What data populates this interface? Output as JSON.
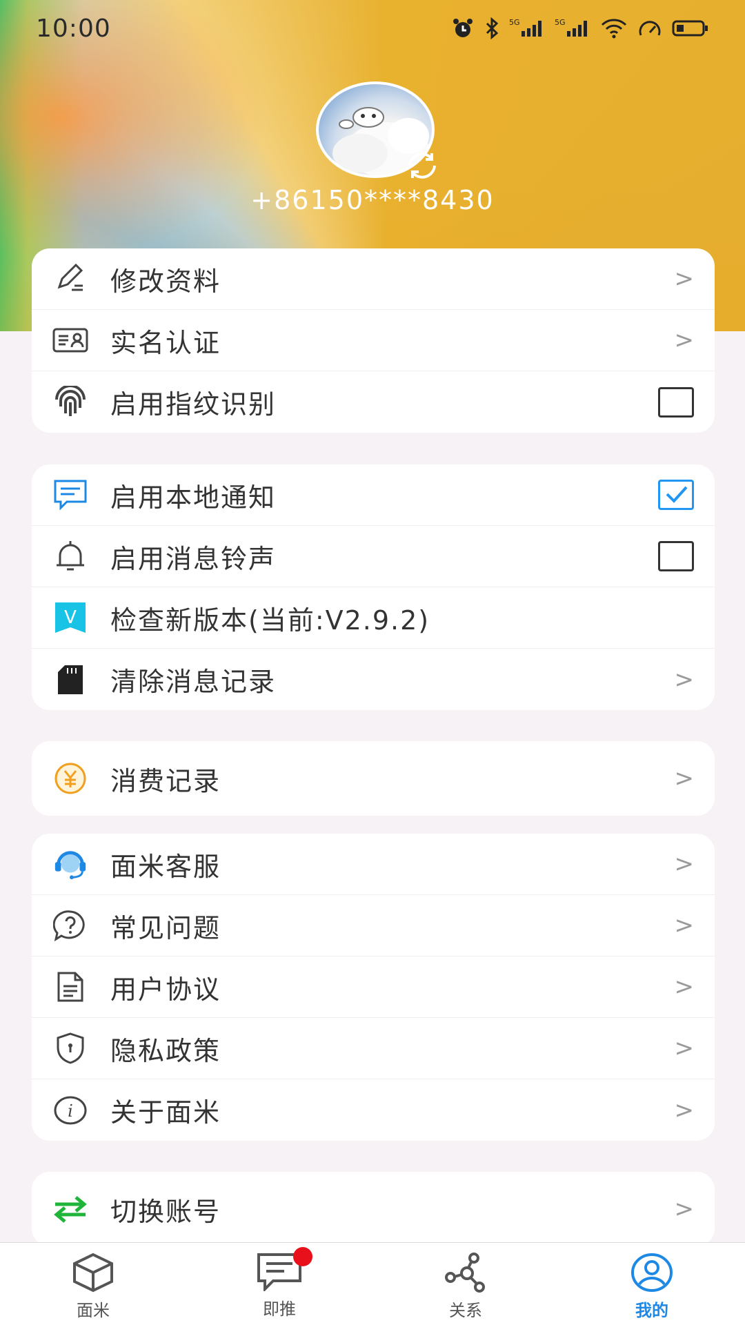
{
  "status_bar": {
    "time": "10:00"
  },
  "profile": {
    "phone": "+86150****8430"
  },
  "groups": [
    {
      "items": [
        {
          "label": "修改资料",
          "icon": "edit-icon",
          "control": ">"
        },
        {
          "label": "实名认证",
          "icon": "id-card-icon",
          "control": ">"
        },
        {
          "label": "启用指纹识别",
          "icon": "fingerprint-icon",
          "checked": false
        }
      ]
    },
    {
      "items": [
        {
          "label": "启用本地通知",
          "icon": "message-icon",
          "checked": true
        },
        {
          "label": "启用消息铃声",
          "icon": "bell-icon",
          "checked": false
        },
        {
          "label": "检查新版本(当前:V2.9.2)",
          "icon": "version-icon"
        },
        {
          "label": "清除消息记录",
          "icon": "sd-card-icon",
          "control": ">"
        }
      ]
    },
    {
      "items": [
        {
          "label": "消费记录",
          "icon": "yuan-icon",
          "control": ">"
        }
      ]
    },
    {
      "items": [
        {
          "label": "面米客服",
          "icon": "customer-service-icon",
          "control": ">"
        },
        {
          "label": "常见问题",
          "icon": "question-icon",
          "control": ">"
        },
        {
          "label": "用户协议",
          "icon": "document-icon",
          "control": ">"
        },
        {
          "label": "隐私政策",
          "icon": "shield-icon",
          "control": ">"
        },
        {
          "label": "关于面米",
          "icon": "info-icon",
          "control": ">"
        }
      ]
    },
    {
      "items": [
        {
          "label": "切换账号",
          "icon": "switch-icon",
          "control": ">"
        }
      ]
    }
  ],
  "version_badge": "V",
  "tabbar": {
    "tabs": [
      {
        "label": "面米",
        "icon": "cube-icon",
        "active": false
      },
      {
        "label": "即推",
        "icon": "chat-icon",
        "active": false
      },
      {
        "label": "关系",
        "icon": "network-icon",
        "active": false
      },
      {
        "label": "我的",
        "icon": "user-icon",
        "active": true
      }
    ]
  },
  "colors": {
    "accent": "#2196f3",
    "badge": "#e8111b",
    "hero_gold": "#e8b12e"
  }
}
